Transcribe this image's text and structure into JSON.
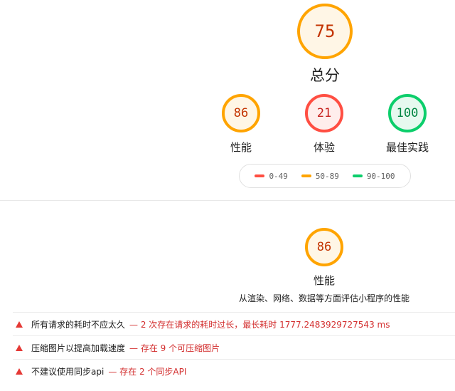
{
  "overall": {
    "score": "75",
    "label": "总分"
  },
  "categories": [
    {
      "score": "86",
      "label": "性能",
      "status": "orange"
    },
    {
      "score": "21",
      "label": "体验",
      "status": "red"
    },
    {
      "score": "100",
      "label": "最佳实践",
      "status": "green"
    }
  ],
  "legend": [
    {
      "range": "0-49",
      "color": "#ff4e42"
    },
    {
      "range": "50-89",
      "color": "#ffa400"
    },
    {
      "range": "90-100",
      "color": "#0cce6b"
    }
  ],
  "section": {
    "score": "86",
    "title": "性能",
    "subtitle": "从渲染、网络、数据等方面评估小程序的性能"
  },
  "audits": [
    {
      "title": "所有请求的耗时不应太久",
      "detail": "— 2 次存在请求的耗时过长，最长耗时 1777.2483929727543 ms"
    },
    {
      "title": "压缩图片以提高加载速度",
      "detail": "— 存在 9 个可压缩图片"
    },
    {
      "title": "不建议使用同步api",
      "detail": "— 存在 2 个同步API"
    }
  ],
  "colors": {
    "pass": "#0cce6b",
    "average": "#ffa400",
    "fail": "#ff4e42"
  }
}
